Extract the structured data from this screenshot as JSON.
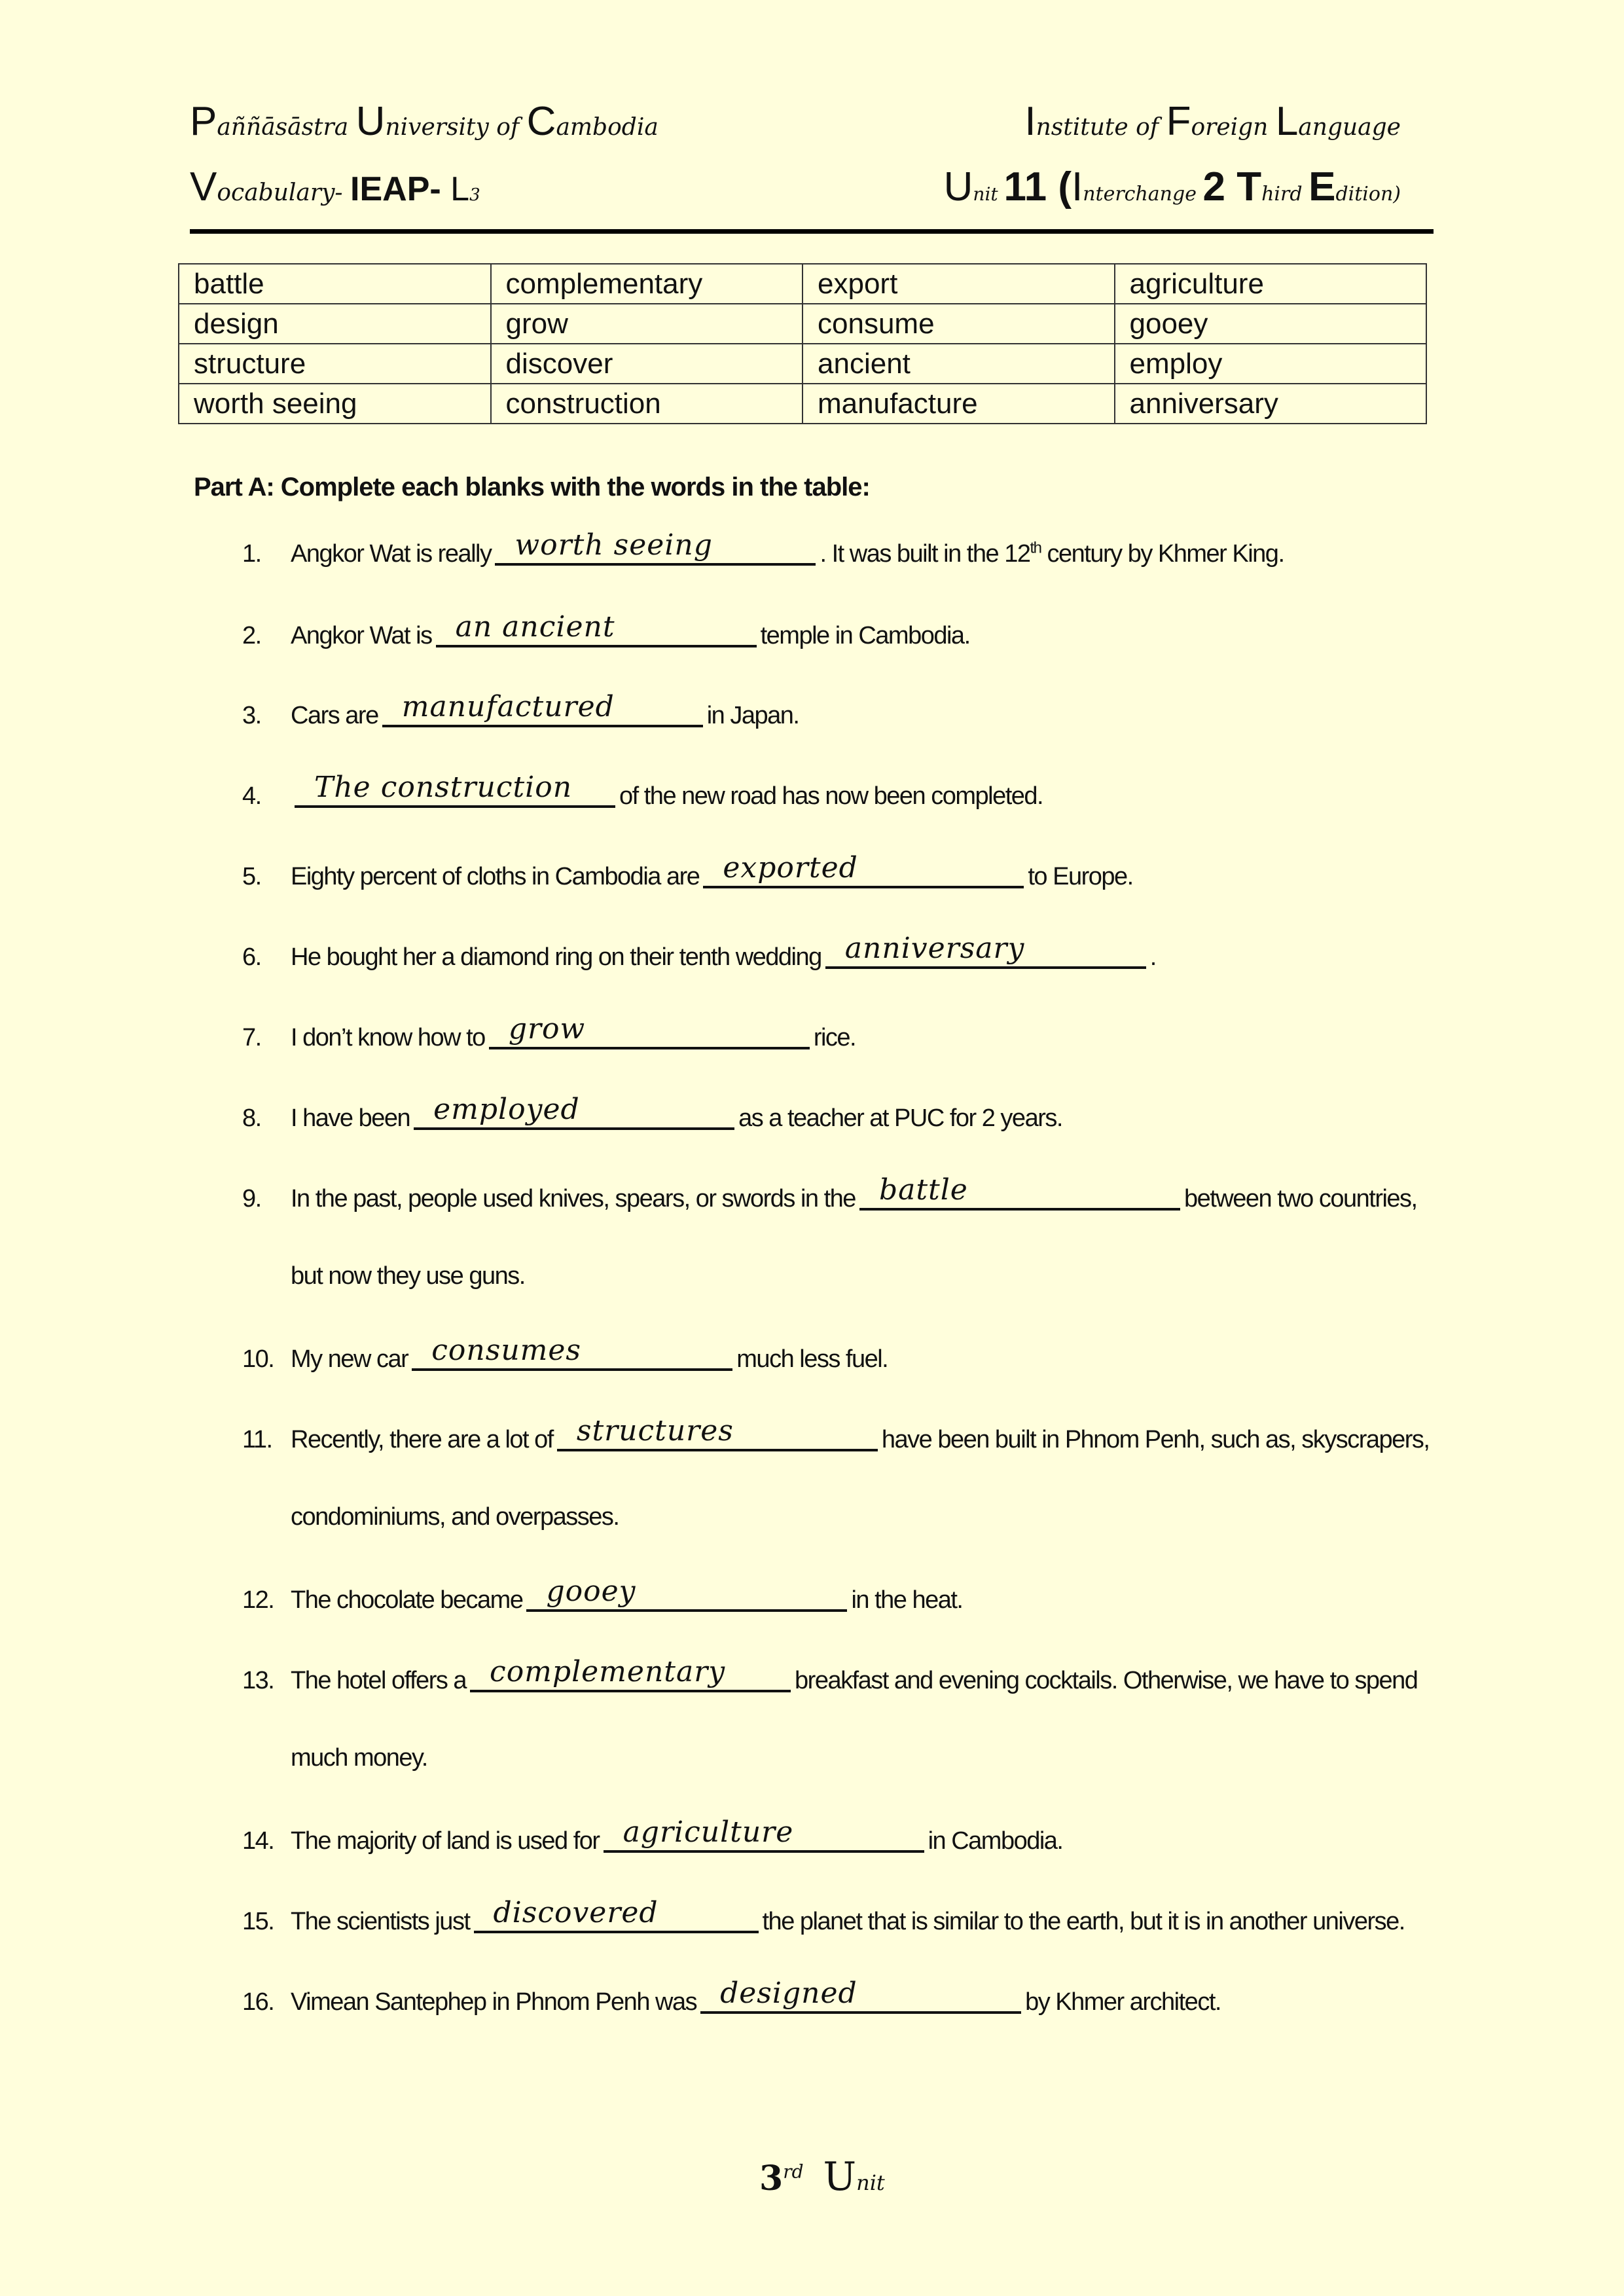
{
  "header": {
    "university": {
      "c1": "P",
      "t1": "aññāsāstra ",
      "c2": "U",
      "t2": "niversity of ",
      "c3": "C",
      "t3": "ambodia"
    },
    "subject": {
      "c1": "V",
      "t1": "ocabulary- ",
      "c2": "IEAP-",
      "t2": " L",
      "t3": "3"
    },
    "institute": {
      "c1": "I",
      "t1": "nstitute of ",
      "c2": "F",
      "t2": "oreign ",
      "c3": "L",
      "t3": "anguage"
    },
    "unit": {
      "c1": "U",
      "t1": "nit ",
      "c2": "11 (",
      "c3": "I",
      "t3": "nterchange ",
      "c4": "2 T",
      "t4": "hird ",
      "c5": "E",
      "t5": "dition)"
    }
  },
  "vocab_table": [
    [
      "battle",
      "complementary",
      "export",
      "agriculture"
    ],
    [
      "design",
      "grow",
      "consume",
      "gooey"
    ],
    [
      "structure",
      "discover",
      "ancient",
      "employ"
    ],
    [
      "worth seeing",
      "construction",
      "manufacture",
      "anniversary"
    ]
  ],
  "part_a": {
    "title": "Part A: Complete each blanks with the words in the table:",
    "items": [
      {
        "num": "1.",
        "before": "Angkor Wat is really",
        "answer": "worth seeing",
        "after": ". It was built in the 12",
        "sup": "th",
        "after2": " century by Khmer King."
      },
      {
        "num": "2.",
        "before": "Angkor Wat is",
        "answer": "an ancient",
        "after": "temple in Cambodia."
      },
      {
        "num": "3.",
        "before": "Cars are",
        "answer": "manufactured",
        "after": "in Japan."
      },
      {
        "num": "4.",
        "before": "",
        "answer": "The construction",
        "after": "of the new road has now been completed."
      },
      {
        "num": "5.",
        "before": "Eighty percent of cloths in Cambodia are",
        "answer": "exported",
        "after": "to Europe."
      },
      {
        "num": "6.",
        "before": "He bought her a diamond ring on their tenth wedding",
        "answer": "anniversary",
        "after": "."
      },
      {
        "num": "7.",
        "before": "I don’t know how to",
        "answer": "grow",
        "after": "rice."
      },
      {
        "num": "8.",
        "before": "I have been",
        "answer": "employed",
        "after": "as a teacher at PUC for 2 years."
      },
      {
        "num": "9.",
        "before": "In the past, people used knives, spears, or swords in the",
        "answer": "battle",
        "after": "between two countries,",
        "line2": "but now they use guns."
      },
      {
        "num": "10.",
        "before": "My new car",
        "answer": "consumes",
        "after": "much less fuel."
      },
      {
        "num": "11.",
        "before": "Recently, there are a lot of",
        "answer": "structures",
        "after": "have been built in Phnom Penh, such as, skyscrapers,",
        "line2": "condominiums, and overpasses."
      },
      {
        "num": "12.",
        "before": "The chocolate became",
        "answer": "gooey",
        "after": "in the heat."
      },
      {
        "num": "13.",
        "before": "The hotel offers a",
        "answer": "complementary",
        "after": "breakfast and evening cocktails. Otherwise, we have to spend",
        "line2": "much money."
      },
      {
        "num": "14.",
        "before": "The majority of land is used for",
        "answer": "agriculture",
        "after": "in Cambodia."
      },
      {
        "num": "15.",
        "before": "The scientists just",
        "answer": "discovered",
        "after": "the planet that is similar to the earth, but it is in another universe."
      },
      {
        "num": "16.",
        "before": "Vimean Santephep in Phnom Penh was",
        "answer": "designed",
        "after": "by Khmer architect."
      }
    ]
  },
  "footer": {
    "num": "3",
    "sup": "rd",
    "unit_cap": "U",
    "unit_rest": "nit"
  }
}
